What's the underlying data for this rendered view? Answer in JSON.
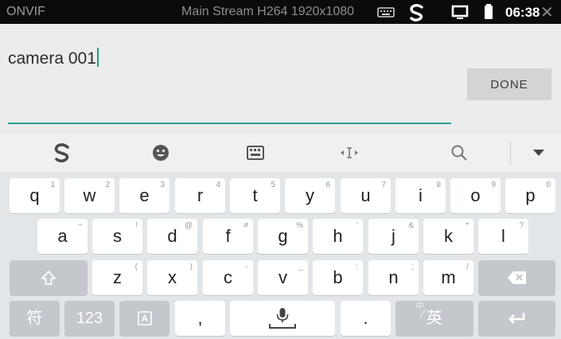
{
  "status_bar": {
    "app_name": "ONVIF",
    "stream_info": "Main Stream H264 1920x1080",
    "time": "06:38",
    "icons": [
      "keyboard-icon",
      "sogou-icon",
      "screen-icon",
      "battery-icon",
      "close-icon"
    ]
  },
  "editor": {
    "value": "camera 001",
    "done_label": "DONE"
  },
  "toolbar": {
    "icons": [
      "sogou-logo-icon",
      "emoji-icon",
      "keyboard-icon",
      "cursor-move-icon",
      "search-icon",
      "collapse-icon"
    ]
  },
  "keyboard": {
    "row1": [
      {
        "key": "q",
        "hint": "1"
      },
      {
        "key": "w",
        "hint": "2"
      },
      {
        "key": "e",
        "hint": "3"
      },
      {
        "key": "r",
        "hint": "4"
      },
      {
        "key": "t",
        "hint": "5"
      },
      {
        "key": "y",
        "hint": "6"
      },
      {
        "key": "u",
        "hint": "7"
      },
      {
        "key": "i",
        "hint": "8"
      },
      {
        "key": "o",
        "hint": "9"
      },
      {
        "key": "p",
        "hint": "0"
      }
    ],
    "row2": [
      {
        "key": "a",
        "hint": "~"
      },
      {
        "key": "s",
        "hint": "!"
      },
      {
        "key": "d",
        "hint": "@"
      },
      {
        "key": "f",
        "hint": "#"
      },
      {
        "key": "g",
        "hint": "%"
      },
      {
        "key": "h",
        "hint": "'"
      },
      {
        "key": "j",
        "hint": "&"
      },
      {
        "key": "k",
        "hint": "*"
      },
      {
        "key": "l",
        "hint": "?"
      }
    ],
    "row3": [
      {
        "key": "z",
        "hint": "("
      },
      {
        "key": "x",
        "hint": ")"
      },
      {
        "key": "c",
        "hint": "-"
      },
      {
        "key": "v",
        "hint": "_"
      },
      {
        "key": "b",
        "hint": ":"
      },
      {
        "key": "n",
        "hint": ";"
      },
      {
        "key": "m",
        "hint": "/"
      }
    ],
    "symbols_label": "符",
    "numbers_label": "123",
    "comma_label": ",",
    "period_label": ".",
    "lang_label": "英",
    "lang_hint": "中"
  }
}
